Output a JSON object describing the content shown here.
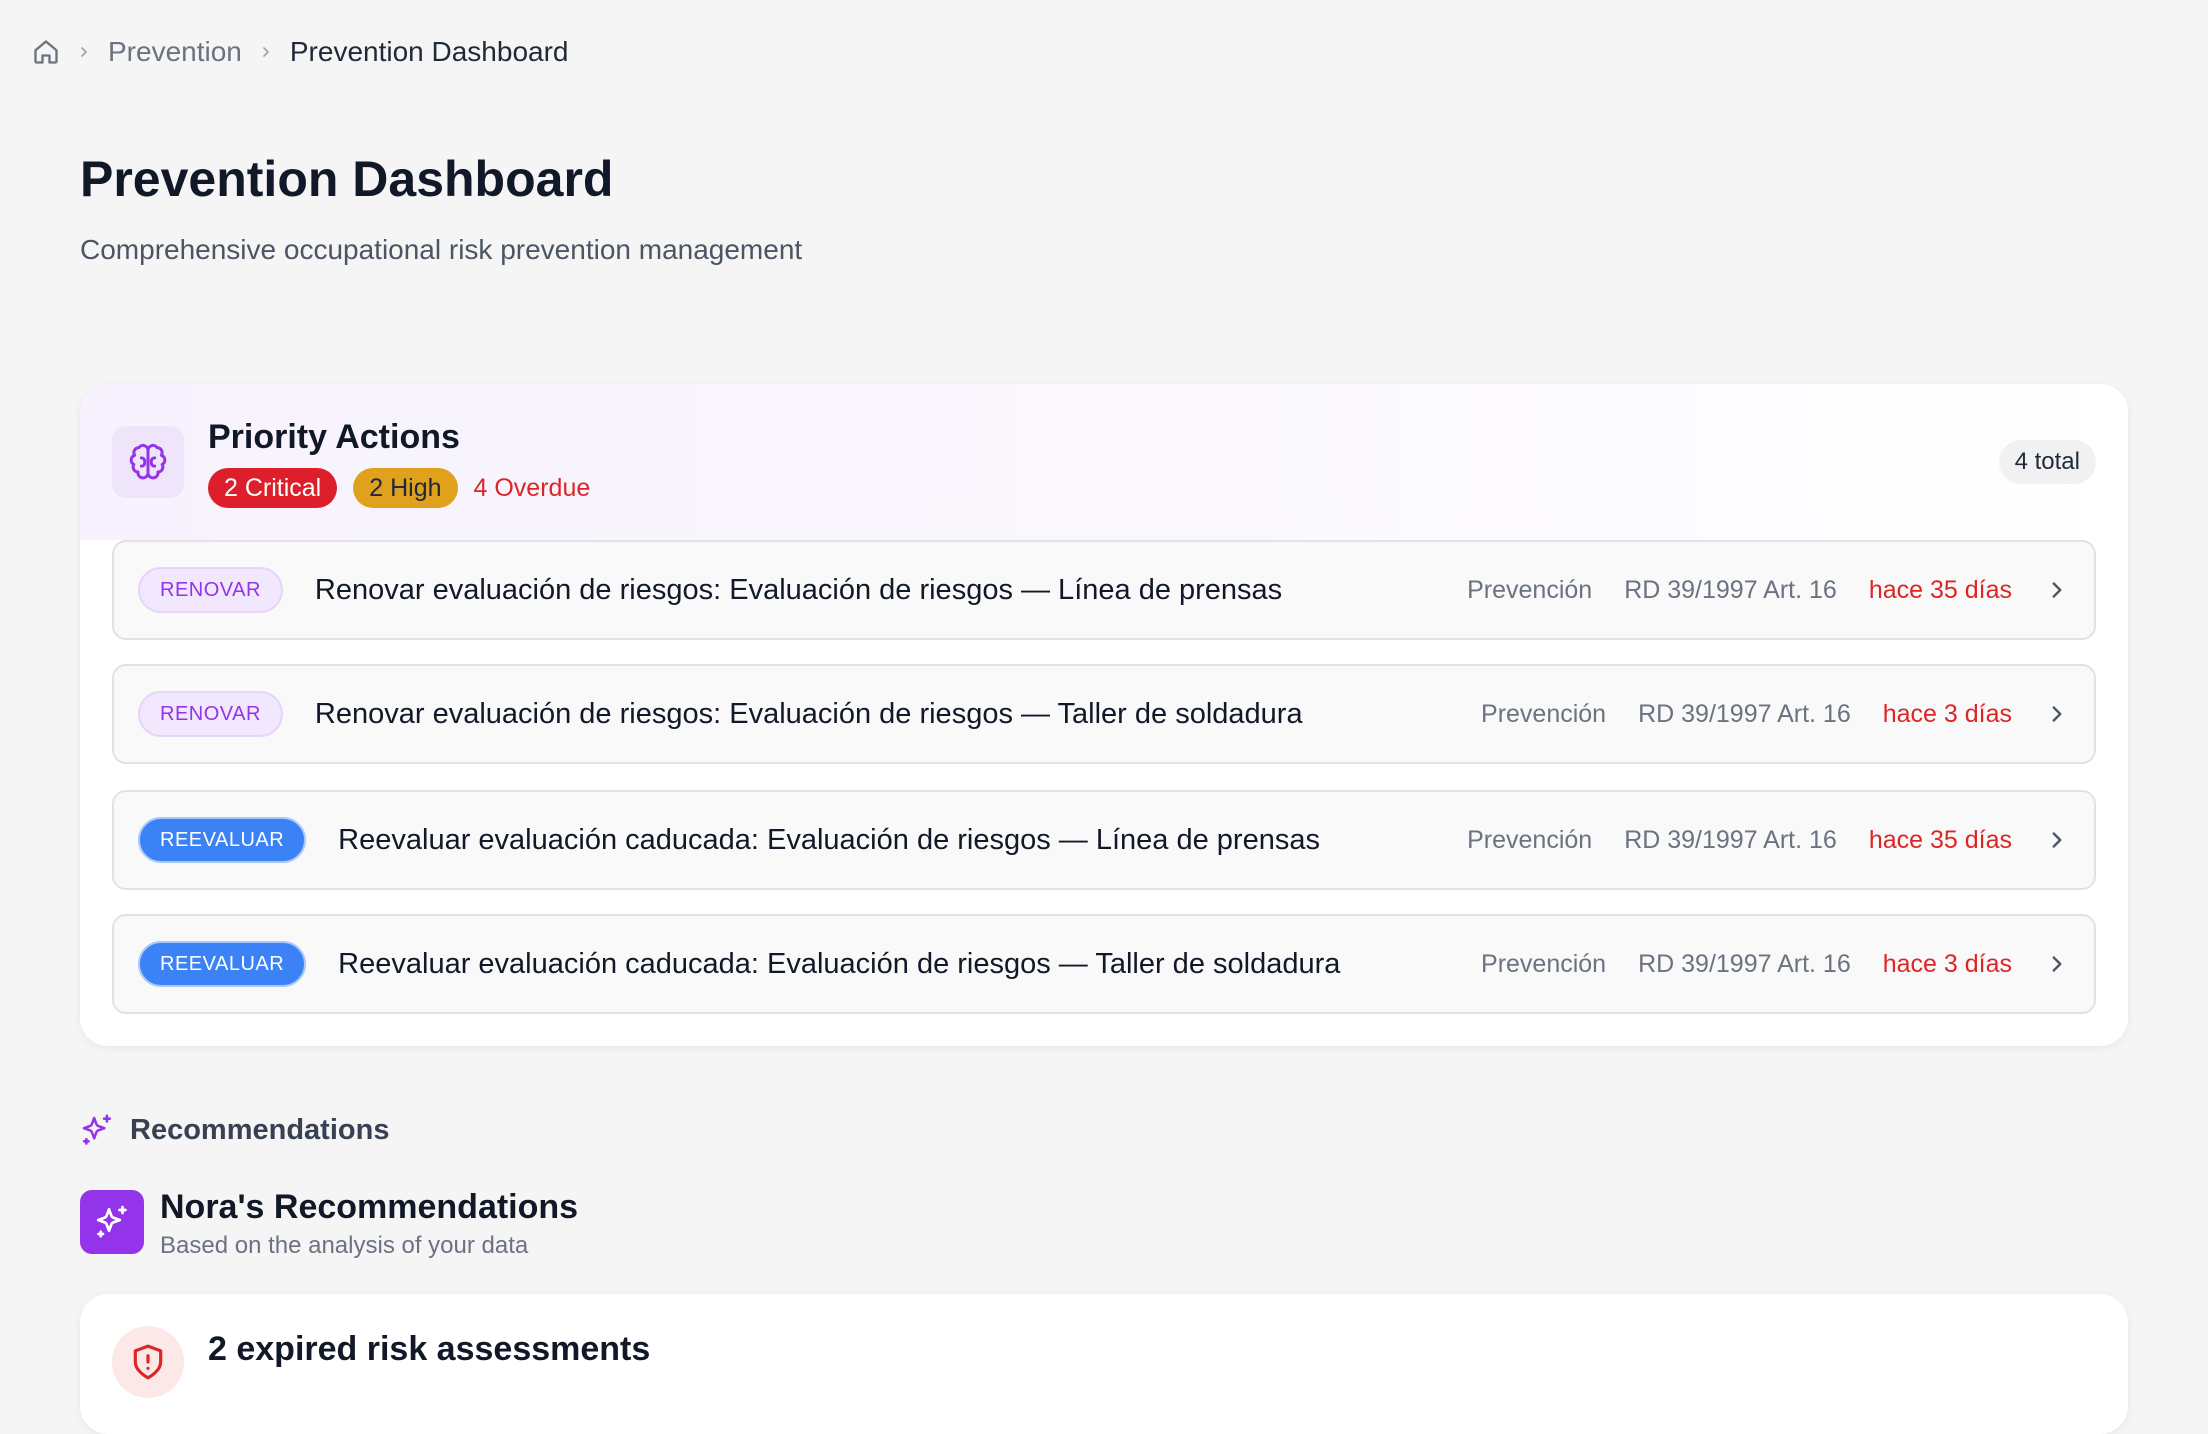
{
  "breadcrumb": {
    "home_icon": "home-icon",
    "items": [
      "Prevention",
      "Prevention Dashboard"
    ]
  },
  "page": {
    "title": "Prevention Dashboard",
    "subtitle": "Comprehensive occupational risk prevention management"
  },
  "priority_actions": {
    "icon": "brain-icon",
    "title": "Priority Actions",
    "critical_label": "2 Critical",
    "high_label": "2 High",
    "overdue_label": "4 Overdue",
    "total_label": "4 total",
    "colors": {
      "critical": "#dc1f2a",
      "high": "#e0a21d",
      "overdue": "#dc2626",
      "renovar_tag": "#9333ea",
      "reevaluar_tag": "#3b82f6"
    },
    "items": [
      {
        "tag": "RENOVAR",
        "title": "Renovar evaluación de riesgos: Evaluación de riesgos — Línea de prensas",
        "area": "Prevención",
        "regulation": "RD 39/1997 Art. 16",
        "ago": "hace 35 días"
      },
      {
        "tag": "RENOVAR",
        "title": "Renovar evaluación de riesgos: Evaluación de riesgos — Taller de soldadura",
        "area": "Prevención",
        "regulation": "RD 39/1997 Art. 16",
        "ago": "hace 3 días"
      },
      {
        "tag": "REEVALUAR",
        "title": "Reevaluar evaluación caducada: Evaluación de riesgos — Línea de prensas",
        "area": "Prevención",
        "regulation": "RD 39/1997 Art. 16",
        "ago": "hace 35 días"
      },
      {
        "tag": "REEVALUAR",
        "title": "Reevaluar evaluación caducada: Evaluación de riesgos — Taller de soldadura",
        "area": "Prevención",
        "regulation": "RD 39/1997 Art. 16",
        "ago": "hace 3 días"
      }
    ]
  },
  "recommendations": {
    "section_label": "Recommendations",
    "section_icon": "sparkles-icon",
    "nora_title": "Nora's Recommendations",
    "nora_subtitle": "Based on the analysis of your data",
    "cards": [
      {
        "icon": "shield-alert-icon",
        "title": "2 expired risk assessments"
      }
    ]
  }
}
